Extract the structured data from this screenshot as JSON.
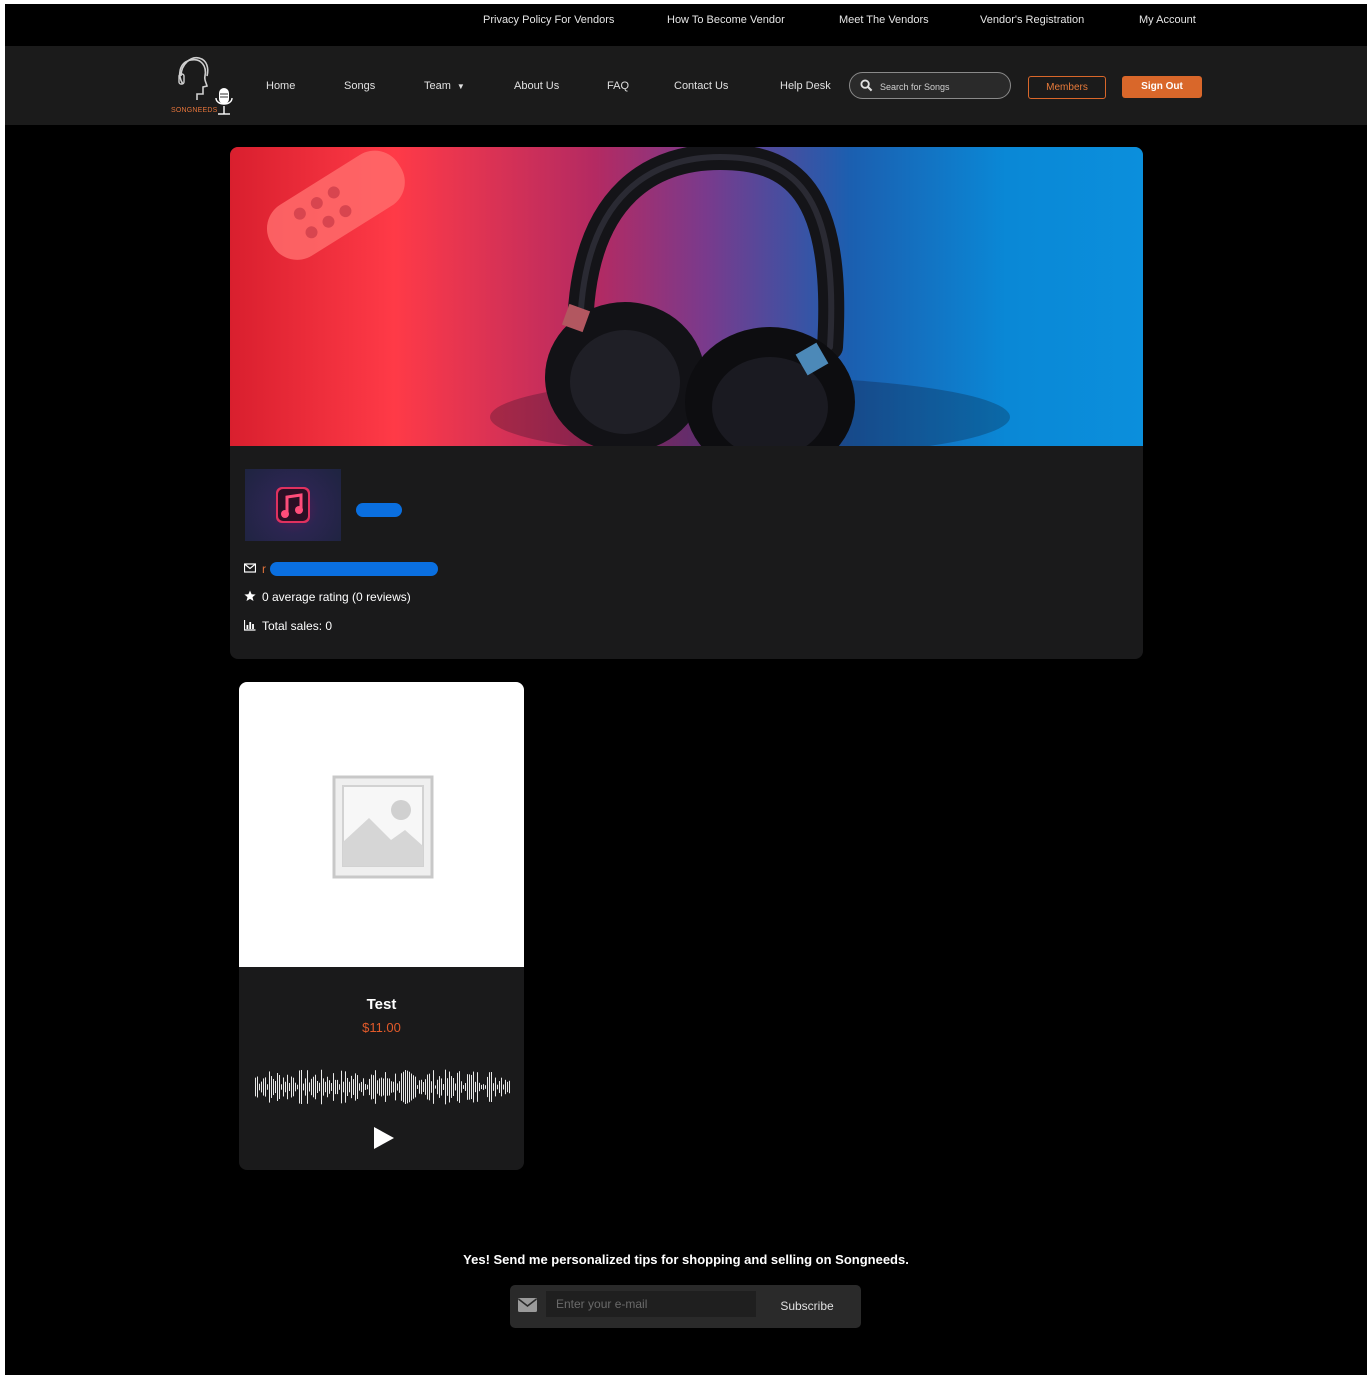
{
  "topbar": {
    "links": [
      "Privacy Policy For Vendors",
      "How To Become Vendor",
      "Meet The Vendors",
      "Vendor's Registration",
      "My Account"
    ]
  },
  "logo": {
    "text": "SONGNEEDS"
  },
  "nav": {
    "home": "Home",
    "songs": "Songs",
    "team": "Team",
    "about": "About Us",
    "faq": "FAQ",
    "contact": "Contact Us",
    "help": "Help Desk",
    "search_placeholder": "Search for Songs",
    "members": "Members",
    "signout": "Sign Out"
  },
  "store": {
    "email_prefix": "r",
    "rating": "0 average rating (0 reviews)",
    "sales": "Total sales: 0"
  },
  "product": {
    "title": "Test",
    "price": "$11.00"
  },
  "newsletter": {
    "text": "Yes! Send me personalized tips for shopping and selling on Songneeds.",
    "placeholder": "Enter your e-mail",
    "button": "Subscribe"
  },
  "colors": {
    "accent": "#d9672a",
    "price": "#e25a2a",
    "redaction": "#0a6fe0"
  }
}
